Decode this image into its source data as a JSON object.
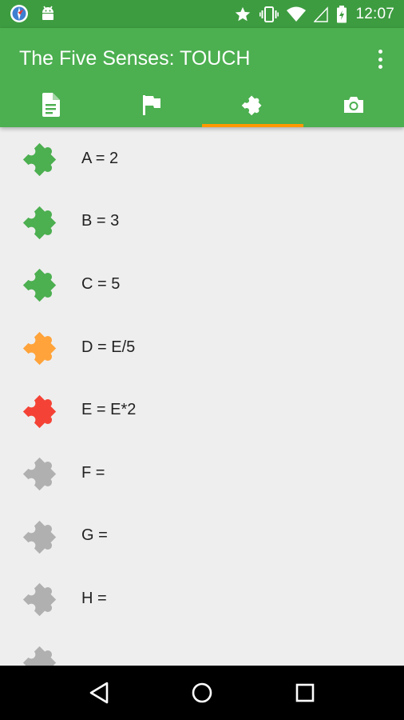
{
  "status_bar": {
    "time": "12:07",
    "icons": [
      "compass-icon",
      "android-icon",
      "star-icon",
      "vibrate-icon",
      "wifi-icon",
      "signal-icon",
      "battery-charging-icon"
    ]
  },
  "app_bar": {
    "title": "The Five Senses: TOUCH",
    "overflow_icon": "more-vert-icon"
  },
  "tabs": [
    {
      "icon": "document-icon",
      "active": false
    },
    {
      "icon": "flag-icon",
      "active": false
    },
    {
      "icon": "puzzle-icon",
      "active": true
    },
    {
      "icon": "camera-icon",
      "active": false
    }
  ],
  "colors": {
    "status_bar": "#3d9c40",
    "app_bar": "#4caf50",
    "tab_indicator": "#ff9800",
    "solved": "#4caf50",
    "partial": "#ffa33a",
    "wrong": "#f44336",
    "empty": "#b0b0b0"
  },
  "puzzles": [
    {
      "label": "A = 2",
      "state": "solved"
    },
    {
      "label": "B = 3",
      "state": "solved"
    },
    {
      "label": "C = 5",
      "state": "solved"
    },
    {
      "label": "D = E/5",
      "state": "partial"
    },
    {
      "label": "E = E*2",
      "state": "wrong"
    },
    {
      "label": "F =",
      "state": "empty"
    },
    {
      "label": "G =",
      "state": "empty"
    },
    {
      "label": "H =",
      "state": "empty"
    },
    {
      "label": "",
      "state": "empty"
    }
  ],
  "nav_bar": [
    "back-icon",
    "home-icon",
    "recents-icon"
  ]
}
